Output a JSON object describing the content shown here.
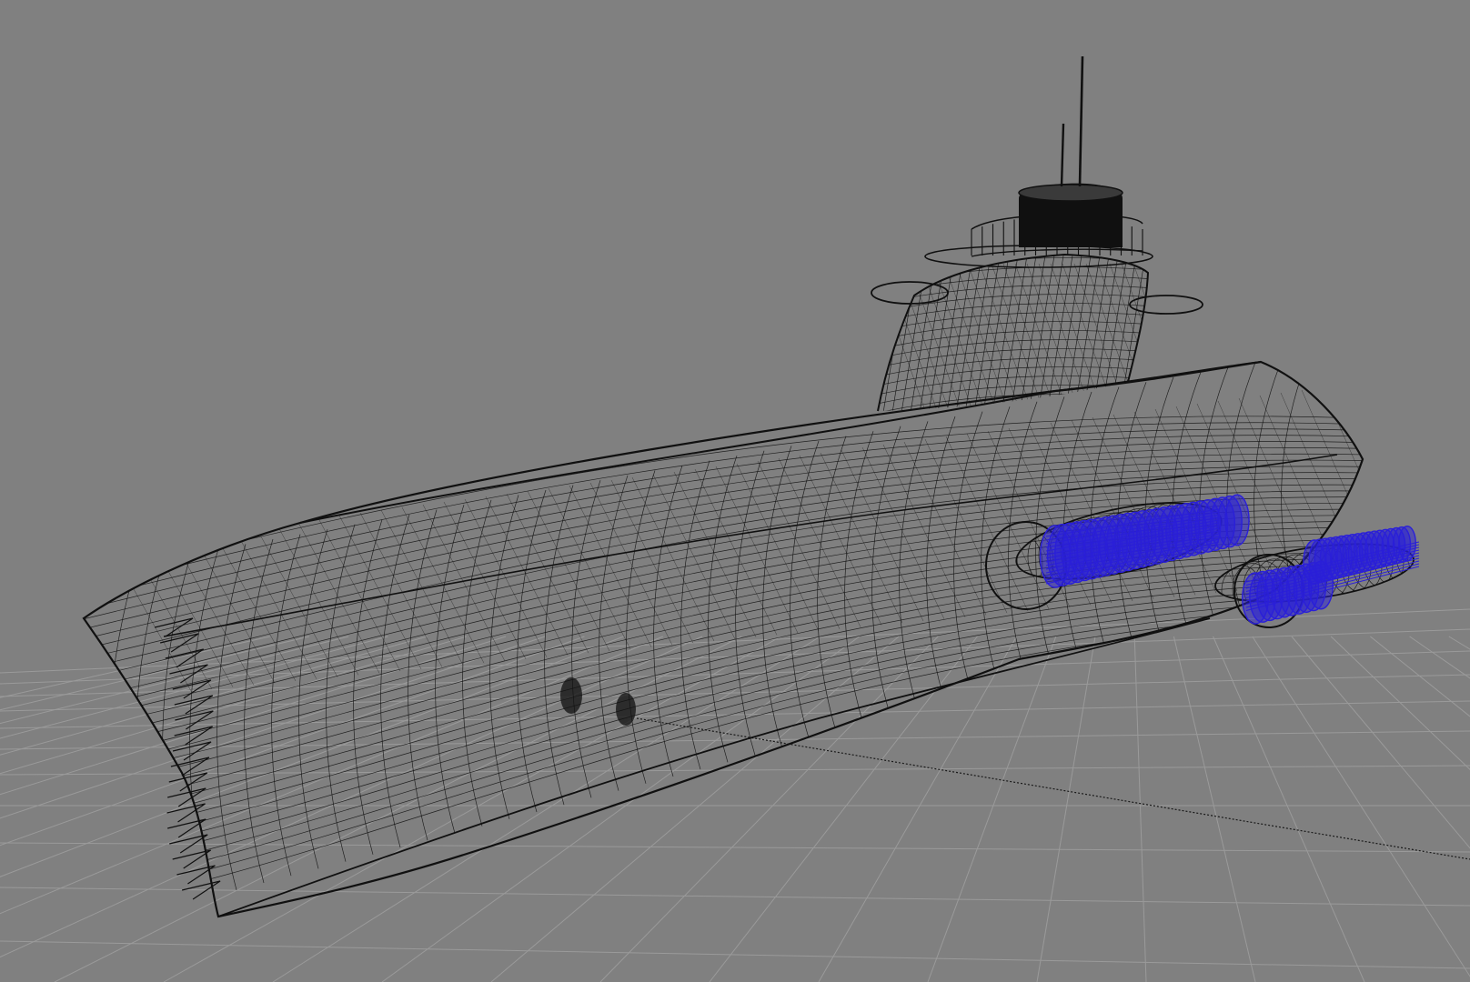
{
  "viewport": {
    "shading_mode": "wireframe",
    "background_color": "#808080",
    "grid_color": "#9a9a9a",
    "axis_color": "#1a1a1a"
  },
  "model": {
    "wire_color": "#101010",
    "highlight_color": "#2a1fd8",
    "parts": [
      "hull-icon",
      "sail-icon",
      "railing-icon",
      "periscope-mast-icon",
      "antenna-mast-icon",
      "port-propulsor-icon",
      "starboard-propulsor-icon"
    ]
  }
}
